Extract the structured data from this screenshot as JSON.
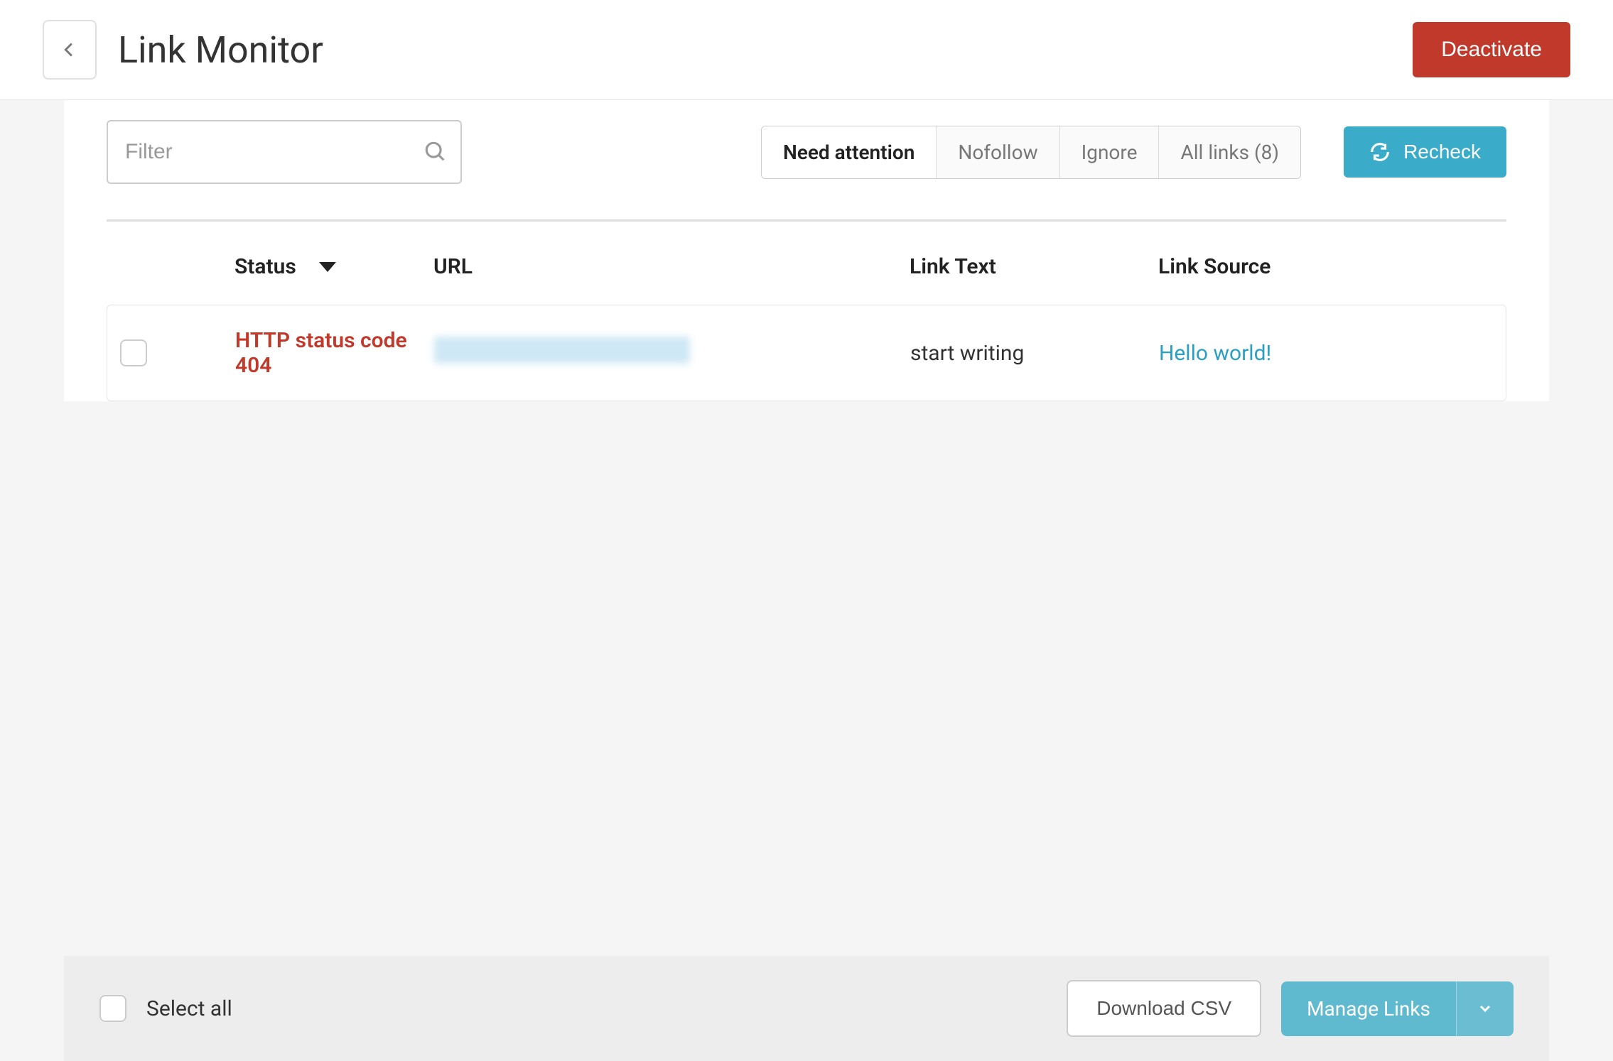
{
  "header": {
    "title": "Link Monitor",
    "deactivate_label": "Deactivate"
  },
  "toolbar": {
    "filter_placeholder": "Filter",
    "tabs": [
      {
        "label": "Need attention",
        "active": true
      },
      {
        "label": "Nofollow",
        "active": false
      },
      {
        "label": "Ignore",
        "active": false
      },
      {
        "label": "All links (8)",
        "active": false
      }
    ],
    "recheck_label": "Recheck"
  },
  "table": {
    "columns": {
      "status": "Status",
      "url": "URL",
      "link_text": "Link Text",
      "link_source": "Link Source"
    },
    "rows": [
      {
        "status": "HTTP status code 404",
        "url_redacted": true,
        "link_text": "start writing",
        "link_source": "Hello world!"
      }
    ]
  },
  "bottom": {
    "select_all_label": "Select all",
    "download_label": "Download CSV",
    "manage_label": "Manage Links"
  }
}
